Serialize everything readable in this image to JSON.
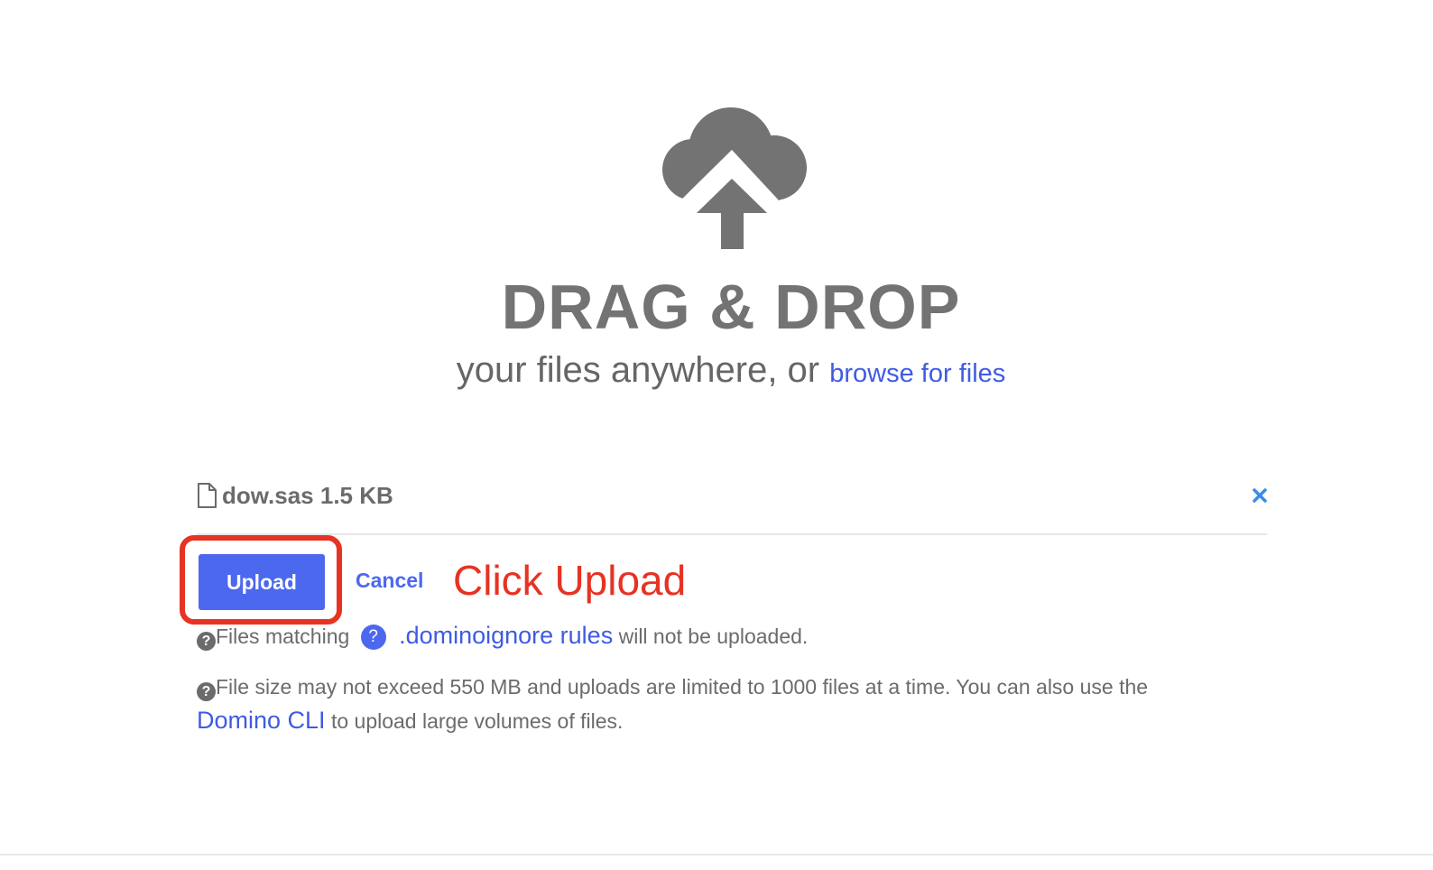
{
  "dropzone": {
    "title": "DRAG & DROP",
    "subtitle": "your files anywhere, or",
    "browse_label": "browse for files",
    "icon": "cloud-upload-icon"
  },
  "file": {
    "icon": "file-icon",
    "name": "dow.sas",
    "size": "1.5 KB",
    "remove_icon": "close-icon"
  },
  "actions": {
    "upload_label": "Upload",
    "cancel_label": "Cancel"
  },
  "annotation": {
    "text": "Click Upload",
    "color": "#e63323"
  },
  "notices": {
    "ignore_prefix": "Files matching",
    "ignore_link": ".dominoignore rules",
    "ignore_suffix": "will not be uploaded.",
    "limit_text": "File size may not exceed 550 MB and uploads are limited to 1000 files at a time. You can also use the",
    "cli_link": "Domino CLI",
    "cli_suffix": "to upload large volumes of files."
  },
  "colors": {
    "accent": "#4c68ef",
    "link": "#3f5be3",
    "heading": "#737373"
  }
}
